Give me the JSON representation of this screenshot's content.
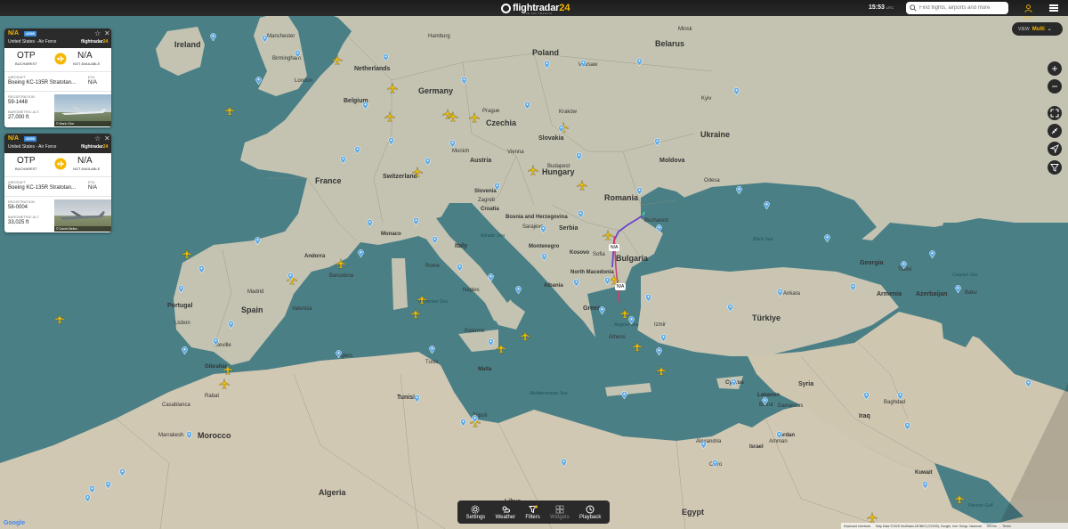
{
  "app": {
    "name": "flightradar",
    "name_suffix": "24",
    "tagline": "LIVE AIR TRAFFIC"
  },
  "header": {
    "clock": "15:53",
    "timezone": "UTC",
    "search_placeholder": "Find flights, airports and more",
    "account_label": "GOLD"
  },
  "view": {
    "label": "VIEW",
    "value": "Multi"
  },
  "toolbar": {
    "items": [
      {
        "label": "Settings",
        "icon": "settings-icon",
        "enabled": true
      },
      {
        "label": "Weather",
        "icon": "weather-icon",
        "enabled": true
      },
      {
        "label": "Filters",
        "icon": "filter-icon",
        "enabled": true
      },
      {
        "label": "Widgets",
        "icon": "widgets-icon",
        "enabled": false
      },
      {
        "label": "Playback",
        "icon": "playback-icon",
        "enabled": true
      }
    ]
  },
  "cards": [
    {
      "callsign": "N/A",
      "badge": "ADSB",
      "operator": "United States - Air Force",
      "brand": "flightradar",
      "brand_suffix": "24",
      "origin_code": "OTP",
      "origin_name": "BUCHAREST",
      "dest_code": "N/A",
      "dest_name": "NOT AVAILABLE",
      "aircraft_label": "AIRCRAFT",
      "aircraft": "Boeing KC-135R Stratotan...",
      "eta_label": "ETA",
      "eta": "N/A",
      "registration_label": "REGISTRATION",
      "registration": "59-1448",
      "altitude_label": "BAROMETRIC ALT.",
      "altitude": "27,000 ft",
      "photo_credit": "© Marin Ghe."
    },
    {
      "callsign": "N/A",
      "badge": "ADSB",
      "operator": "United States - Air Force",
      "brand": "flightradar",
      "brand_suffix": "24",
      "origin_code": "OTP",
      "origin_name": "BUCHAREST",
      "dest_code": "N/A",
      "dest_name": "NOT AVAILABLE",
      "aircraft_label": "AIRCRAFT",
      "aircraft": "Boeing KC-135R Stratotan...",
      "eta_label": "ETA",
      "eta": "N/A",
      "registration_label": "REGISTRATION",
      "registration": "58-0004",
      "altitude_label": "BAROMETRIC ALT.",
      "altitude": "33,025 ft",
      "photo_credit": "© Daniel Beliso"
    }
  ],
  "map": {
    "countries": [
      "Ireland",
      "Netherlands",
      "Germany",
      "Poland",
      "Belarus",
      "Belgium",
      "Czechia",
      "Ukraine",
      "Slovakia",
      "Moldova",
      "France",
      "Switzerland",
      "Austria",
      "Hungary",
      "Romania",
      "Slovenia",
      "Croatia",
      "Bosnia and Herzegovina",
      "Serbia",
      "Monaco",
      "Bulgaria",
      "Montenegro",
      "Kosovo",
      "Andorra",
      "Italy",
      "North Macedonia",
      "Albania",
      "Georgia",
      "Armenia",
      "Azerbaijan",
      "Spain",
      "Portugal",
      "Greece",
      "Türkiye",
      "Tunisia",
      "Malta",
      "Syria",
      "Cyprus",
      "Lebanon",
      "Iraq",
      "Morocco",
      "Israel",
      "Jordan",
      "Algeria",
      "Egypt",
      "Kuwait",
      "Libya",
      "Gibraltar",
      "Damascus",
      "Baghdad"
    ],
    "cities": [
      "Manchester",
      "Birmingham",
      "London",
      "Hamburg",
      "Minsk",
      "Warsaw",
      "Prague",
      "Kraków",
      "Kyiv",
      "Munich",
      "Budapest",
      "Vienna",
      "Odesa",
      "Zagreb",
      "Bucharest",
      "Sarajevo",
      "Sofia",
      "Rome",
      "Naples",
      "Barcelona",
      "Madrid",
      "Valencia",
      "Lisbon",
      "Seville",
      "Ankara",
      "Izmir",
      "Athens",
      "Palermo",
      "Tunis",
      "Algiers",
      "Tripoli",
      "Casablanca",
      "Rabat",
      "Marrakesh",
      "Alexandria",
      "Cairo",
      "Beirut",
      "Amman",
      "Tbilisi",
      "Baku"
    ],
    "seas": [
      "Black Sea",
      "Tyrrhenian Sea",
      "Mediterranean Sea",
      "Caspian Sea",
      "Persian Gulf",
      "Adriatic Sea",
      "Aegean Sea"
    ],
    "route_labels": [
      "N/A",
      "N/A"
    ]
  },
  "attribution": {
    "shortcuts": "Keyboard shortcuts",
    "map_data": "Map Data ©2025 GeoBasis-DE/BKG (©2009), Google, Inst. Geogr. Nacional",
    "scale": "200 km",
    "terms": "Terms",
    "google": "Google"
  },
  "colors": {
    "accent": "#f5b800",
    "route": "#6a44c9",
    "sea": "#4a7f86",
    "land": "#c9c7b5"
  }
}
